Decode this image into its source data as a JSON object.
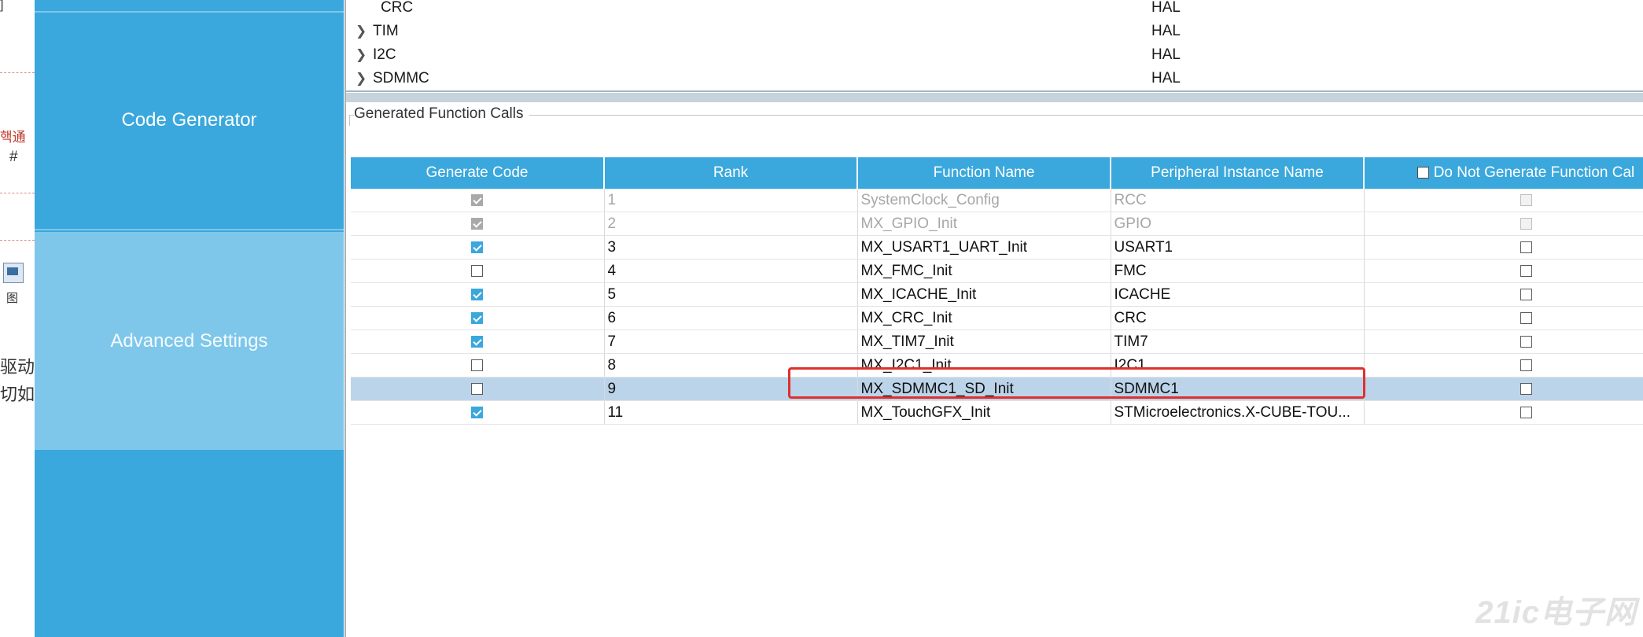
{
  "background_window": {
    "fragments": [
      "핵通",
      "#",
      "图",
      "驱动",
      "切如",
      "]"
    ]
  },
  "sidebar": {
    "items": [
      {
        "label": "Code Generator",
        "active": false
      },
      {
        "label": "Advanced Settings",
        "active": true
      }
    ]
  },
  "driver_tree": {
    "rows": [
      {
        "name": "CRC",
        "driver": "HAL",
        "expandable": false
      },
      {
        "name": "TIM",
        "driver": "HAL",
        "expandable": true
      },
      {
        "name": "I2C",
        "driver": "HAL",
        "expandable": true
      },
      {
        "name": "SDMMC",
        "driver": "HAL",
        "expandable": true
      }
    ]
  },
  "function_calls": {
    "group_title": "Generated Function Calls",
    "columns": {
      "generate_code": "Generate Code",
      "rank": "Rank",
      "function_name": "Function Name",
      "peripheral": "Peripheral Instance Name",
      "do_not_generate": "Do Not Generate Function Cal"
    },
    "rows": [
      {
        "generate": true,
        "rank": "1",
        "function": "SystemClock_Config",
        "peripheral": "RCC",
        "no_call": false,
        "disabled": true,
        "selected": false
      },
      {
        "generate": true,
        "rank": "2",
        "function": "MX_GPIO_Init",
        "peripheral": "GPIO",
        "no_call": false,
        "disabled": true,
        "selected": false
      },
      {
        "generate": true,
        "rank": "3",
        "function": "MX_USART1_UART_Init",
        "peripheral": "USART1",
        "no_call": false,
        "disabled": false,
        "selected": false
      },
      {
        "generate": false,
        "rank": "4",
        "function": "MX_FMC_Init",
        "peripheral": "FMC",
        "no_call": false,
        "disabled": false,
        "selected": false
      },
      {
        "generate": true,
        "rank": "5",
        "function": "MX_ICACHE_Init",
        "peripheral": "ICACHE",
        "no_call": false,
        "disabled": false,
        "selected": false
      },
      {
        "generate": true,
        "rank": "6",
        "function": "MX_CRC_Init",
        "peripheral": "CRC",
        "no_call": false,
        "disabled": false,
        "selected": false
      },
      {
        "generate": true,
        "rank": "7",
        "function": "MX_TIM7_Init",
        "peripheral": "TIM7",
        "no_call": false,
        "disabled": false,
        "selected": false
      },
      {
        "generate": false,
        "rank": "8",
        "function": "MX_I2C1_Init",
        "peripheral": "I2C1",
        "no_call": false,
        "disabled": false,
        "selected": false
      },
      {
        "generate": false,
        "rank": "9",
        "function": "MX_SDMMC1_SD_Init",
        "peripheral": "SDMMC1",
        "no_call": false,
        "disabled": false,
        "selected": true
      },
      {
        "generate": true,
        "rank": "11",
        "function": "MX_TouchGFX_Init",
        "peripheral": "STMicroelectronics.X-CUBE-TOU...",
        "no_call": false,
        "disabled": false,
        "selected": false
      }
    ]
  },
  "watermark": "21ic电子网",
  "colors": {
    "accent": "#3aa8dd",
    "active_item": "#7ec7ea",
    "selection": "#bcd4ea",
    "annotation": "#e0302c"
  }
}
